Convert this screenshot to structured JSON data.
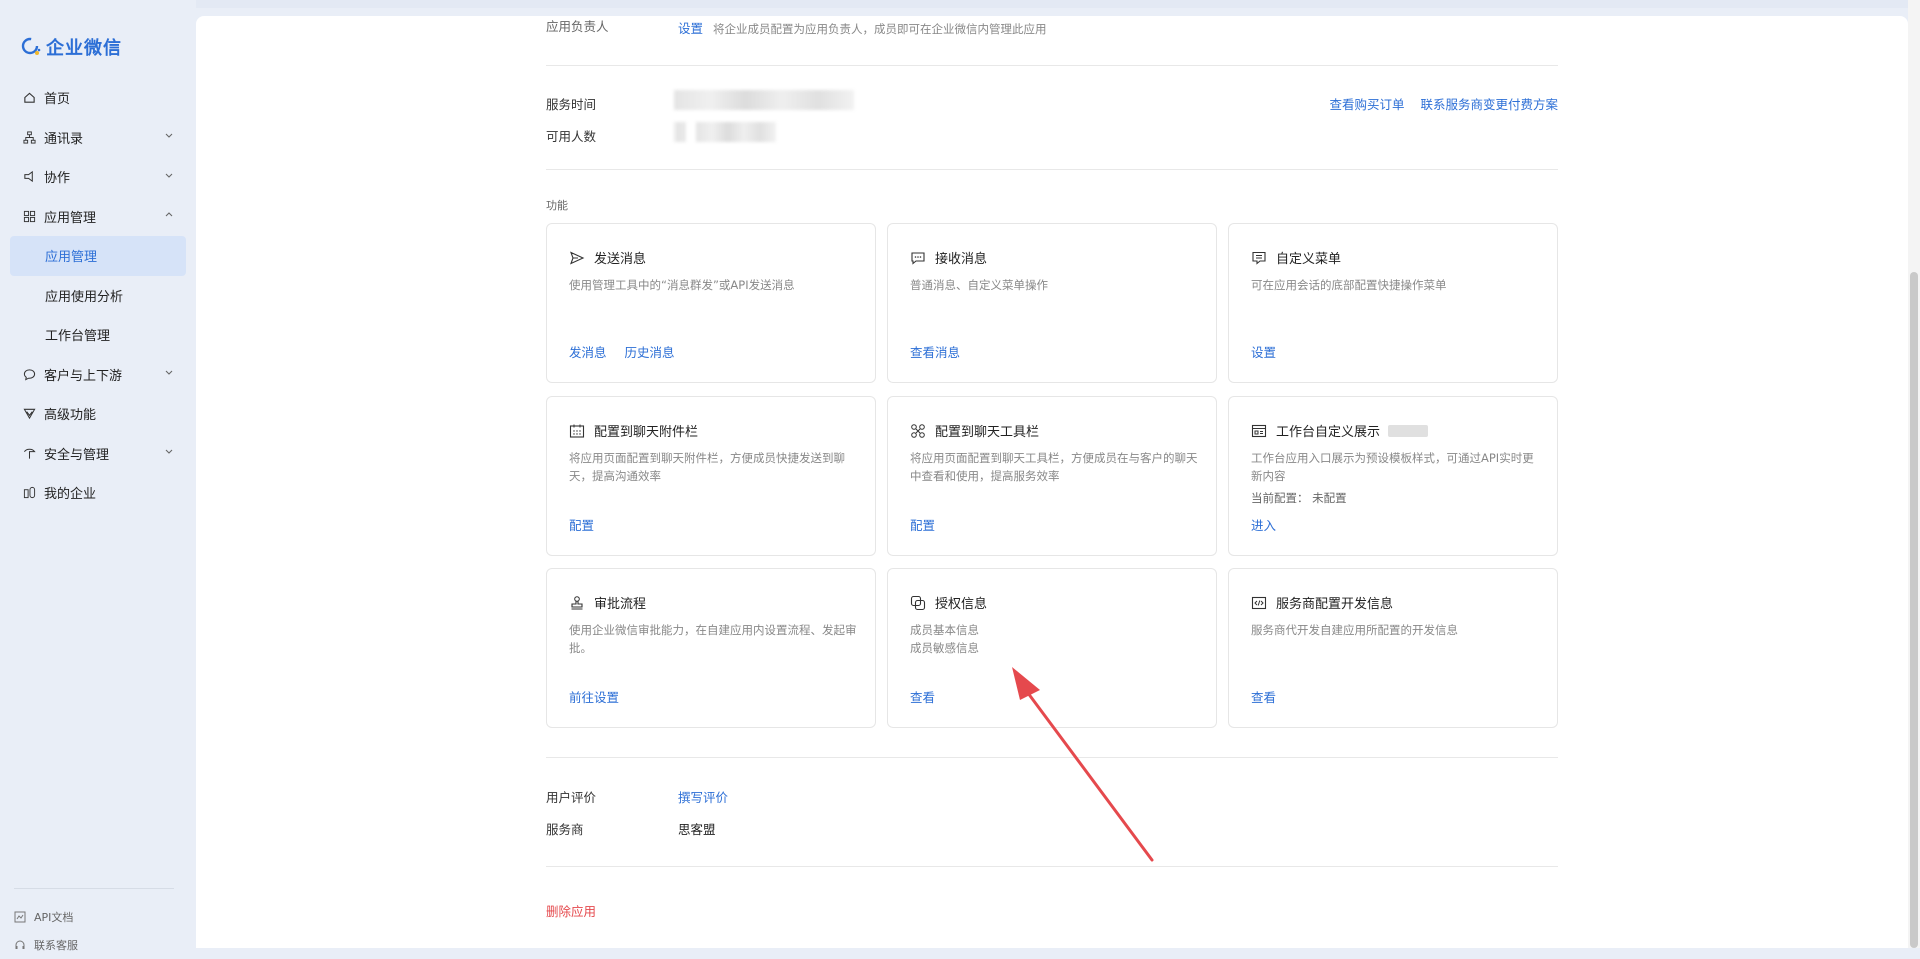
{
  "brand": {
    "name": "企业微信",
    "color": "#2d6fd6"
  },
  "sidebar": {
    "items": [
      {
        "label": "首页",
        "icon": "home-icon"
      },
      {
        "label": "通讯录",
        "icon": "org-icon",
        "expand": "down"
      },
      {
        "label": "协作",
        "icon": "collab-icon",
        "expand": "down"
      },
      {
        "label": "应用管理",
        "icon": "apps-icon",
        "expand": "up"
      },
      {
        "label": "应用管理",
        "sub": true,
        "active": true
      },
      {
        "label": "应用使用分析",
        "sub": true
      },
      {
        "label": "工作台管理",
        "sub": true
      },
      {
        "label": "客户与上下游",
        "icon": "chat-icon",
        "expand": "down"
      },
      {
        "label": "高级功能",
        "icon": "advanced-icon"
      },
      {
        "label": "安全与管理",
        "icon": "security-icon",
        "expand": "down"
      },
      {
        "label": "我的企业",
        "icon": "company-icon"
      }
    ],
    "footer": [
      {
        "label": "API文档",
        "icon": "api-doc-icon"
      },
      {
        "label": "联系客服",
        "icon": "support-icon"
      }
    ]
  },
  "app_owner": {
    "label": "应用负责人",
    "action": "设置",
    "desc": "将企业成员配置为应用负责人，成员即可在企业微信内管理此应用"
  },
  "service": {
    "time_label": "服务时间",
    "users_label": "可用人数",
    "view_orders": "查看购买订单",
    "contact_provider": "联系服务商变更付费方案"
  },
  "features": {
    "title": "功能",
    "cards": [
      {
        "title": "发送消息",
        "icon": "send-icon",
        "desc": "使用管理工具中的“消息群发”或API发送消息",
        "actions": [
          "发消息",
          "历史消息"
        ]
      },
      {
        "title": "接收消息",
        "icon": "message-icon",
        "desc": "普通消息、自定义菜单操作",
        "actions": [
          "查看消息"
        ]
      },
      {
        "title": "自定义菜单",
        "icon": "menu-icon",
        "desc": "可在应用会话的底部配置快捷操作菜单",
        "actions": [
          "设置"
        ]
      },
      {
        "title": "配置到聊天附件栏",
        "icon": "attachment-grid-icon",
        "desc": "将应用页面配置到聊天附件栏，方便成员快捷发送到聊天，提高沟通效率",
        "actions": [
          "配置"
        ]
      },
      {
        "title": "配置到聊天工具栏",
        "icon": "toolbar-icon",
        "desc": "将应用页面配置到聊天工具栏，方便成员在与客户的聊天中查看和使用，提高服务效率",
        "actions": [
          "配置"
        ]
      },
      {
        "title": "工作台自定义展示",
        "icon": "workbench-icon",
        "desc": "工作台应用入口展示为预设模板样式，可通过API实时更新内容",
        "extra": "当前配置： 未配置",
        "badge": true,
        "actions": [
          "进入"
        ]
      },
      {
        "title": "审批流程",
        "icon": "stamp-icon",
        "desc": "使用企业微信审批能力，在自建应用内设置流程、发起审批。",
        "actions": [
          "前往设置"
        ]
      },
      {
        "title": "授权信息",
        "icon": "auth-icon",
        "desc": "成员基本信息",
        "extra": "成员敏感信息",
        "actions": [
          "查看"
        ]
      },
      {
        "title": "服务商配置开发信息",
        "icon": "code-icon",
        "desc": "服务商代开发自建应用所配置的开发信息",
        "actions": [
          "查看"
        ]
      }
    ]
  },
  "review": {
    "label": "用户评价",
    "action": "撰写评价"
  },
  "provider": {
    "label": "服务商",
    "value": "思客盟"
  },
  "delete": {
    "label": "删除应用",
    "color": "#e5494d"
  },
  "annotation": {
    "color": "#e5494d"
  }
}
